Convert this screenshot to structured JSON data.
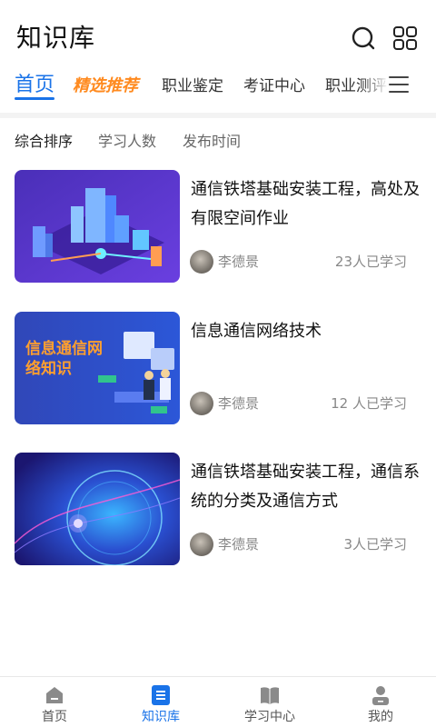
{
  "header": {
    "title": "知识库",
    "search_icon": "search-icon",
    "apps_icon": "apps-grid-icon"
  },
  "tabs": [
    {
      "label": "首页",
      "active": true
    },
    {
      "label": "精选推荐",
      "featured": true
    },
    {
      "label": "职业鉴定"
    },
    {
      "label": "考证中心"
    },
    {
      "label": "职业测评"
    }
  ],
  "tabs_menu_icon": "menu-icon",
  "sort": {
    "options": [
      "综合排序",
      "学习人数",
      "发布时间"
    ],
    "active": "综合排序"
  },
  "courses": [
    {
      "title": "通信铁塔基础安装工程，高处及有限空间作业",
      "author": "李德景",
      "learners": "23人已学习",
      "thumb_label": ""
    },
    {
      "title": "信息通信网络技术",
      "author": "李德景",
      "learners": "12 人已学习",
      "thumb_label": "信息通信网络知识"
    },
    {
      "title": "通信铁塔基础安装工程，通信系统的分类及通信方式",
      "author": "李德景",
      "learners": "3人已学习",
      "thumb_label": ""
    }
  ],
  "bottom_nav": [
    {
      "label": "首页",
      "icon": "home-icon"
    },
    {
      "label": "知识库",
      "icon": "knowledge-icon",
      "active": true
    },
    {
      "label": "学习中心",
      "icon": "book-icon"
    },
    {
      "label": "我的",
      "icon": "profile-icon"
    }
  ],
  "colors": {
    "accent": "#1a73e8",
    "featured": "#ff8a1f",
    "muted": "#888888"
  }
}
